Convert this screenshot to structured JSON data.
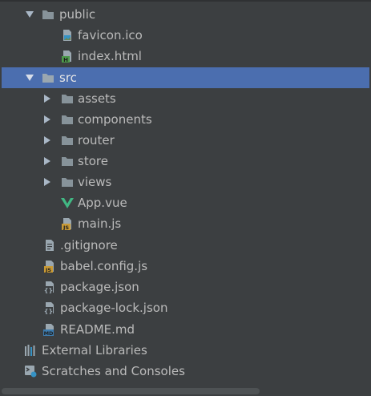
{
  "project_tree": {
    "items": [
      {
        "label": "public",
        "icon": "folder-icon"
      },
      {
        "label": "favicon.ico",
        "icon": "image-file-icon"
      },
      {
        "label": "index.html",
        "icon": "html-file-icon"
      },
      {
        "label": "src",
        "icon": "folder-icon",
        "selected": true
      },
      {
        "label": "assets",
        "icon": "folder-icon"
      },
      {
        "label": "components",
        "icon": "folder-icon"
      },
      {
        "label": "router",
        "icon": "folder-icon"
      },
      {
        "label": "store",
        "icon": "folder-icon"
      },
      {
        "label": "views",
        "icon": "folder-icon"
      },
      {
        "label": "App.vue",
        "icon": "vue-file-icon"
      },
      {
        "label": "main.js",
        "icon": "js-file-icon"
      },
      {
        "label": ".gitignore",
        "icon": "text-file-icon"
      },
      {
        "label": "babel.config.js",
        "icon": "js-file-icon"
      },
      {
        "label": "package.json",
        "icon": "json-file-icon"
      },
      {
        "label": "package-lock.json",
        "icon": "json-file-icon"
      },
      {
        "label": "README.md",
        "icon": "markdown-file-icon"
      },
      {
        "label": "External Libraries",
        "icon": "libraries-icon"
      },
      {
        "label": "Scratches and Consoles",
        "icon": "scratches-icon"
      }
    ]
  },
  "icon_badges": {
    "html": "H",
    "js": "JS",
    "json": "{}",
    "md": "MD"
  },
  "colors": {
    "background": "#3c3f41",
    "selection": "#4b6eaf",
    "text": "#bbbbbb",
    "folder": "#87939a",
    "vue_green": "#41b883",
    "js_badge": "#c99a35",
    "html_badge": "#4d9a4b",
    "md_badge": "#3d7bad"
  }
}
